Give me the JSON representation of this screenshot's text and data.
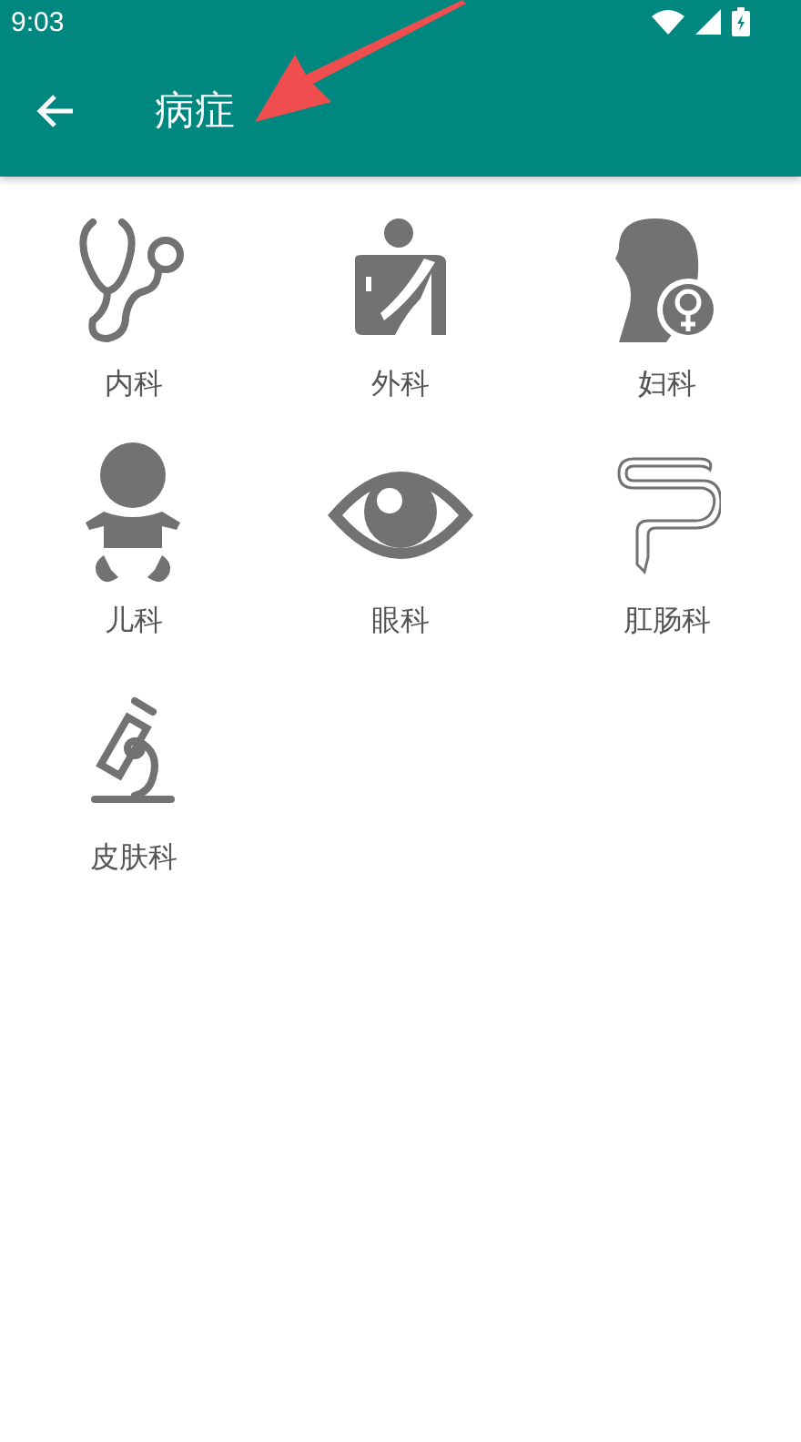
{
  "status_bar": {
    "time": "9:03"
  },
  "toolbar": {
    "title": "病症"
  },
  "departments": [
    {
      "label": "内科"
    },
    {
      "label": "外科"
    },
    {
      "label": "妇科"
    },
    {
      "label": "儿科"
    },
    {
      "label": "眼科"
    },
    {
      "label": "肛肠科"
    },
    {
      "label": "皮肤科"
    }
  ]
}
